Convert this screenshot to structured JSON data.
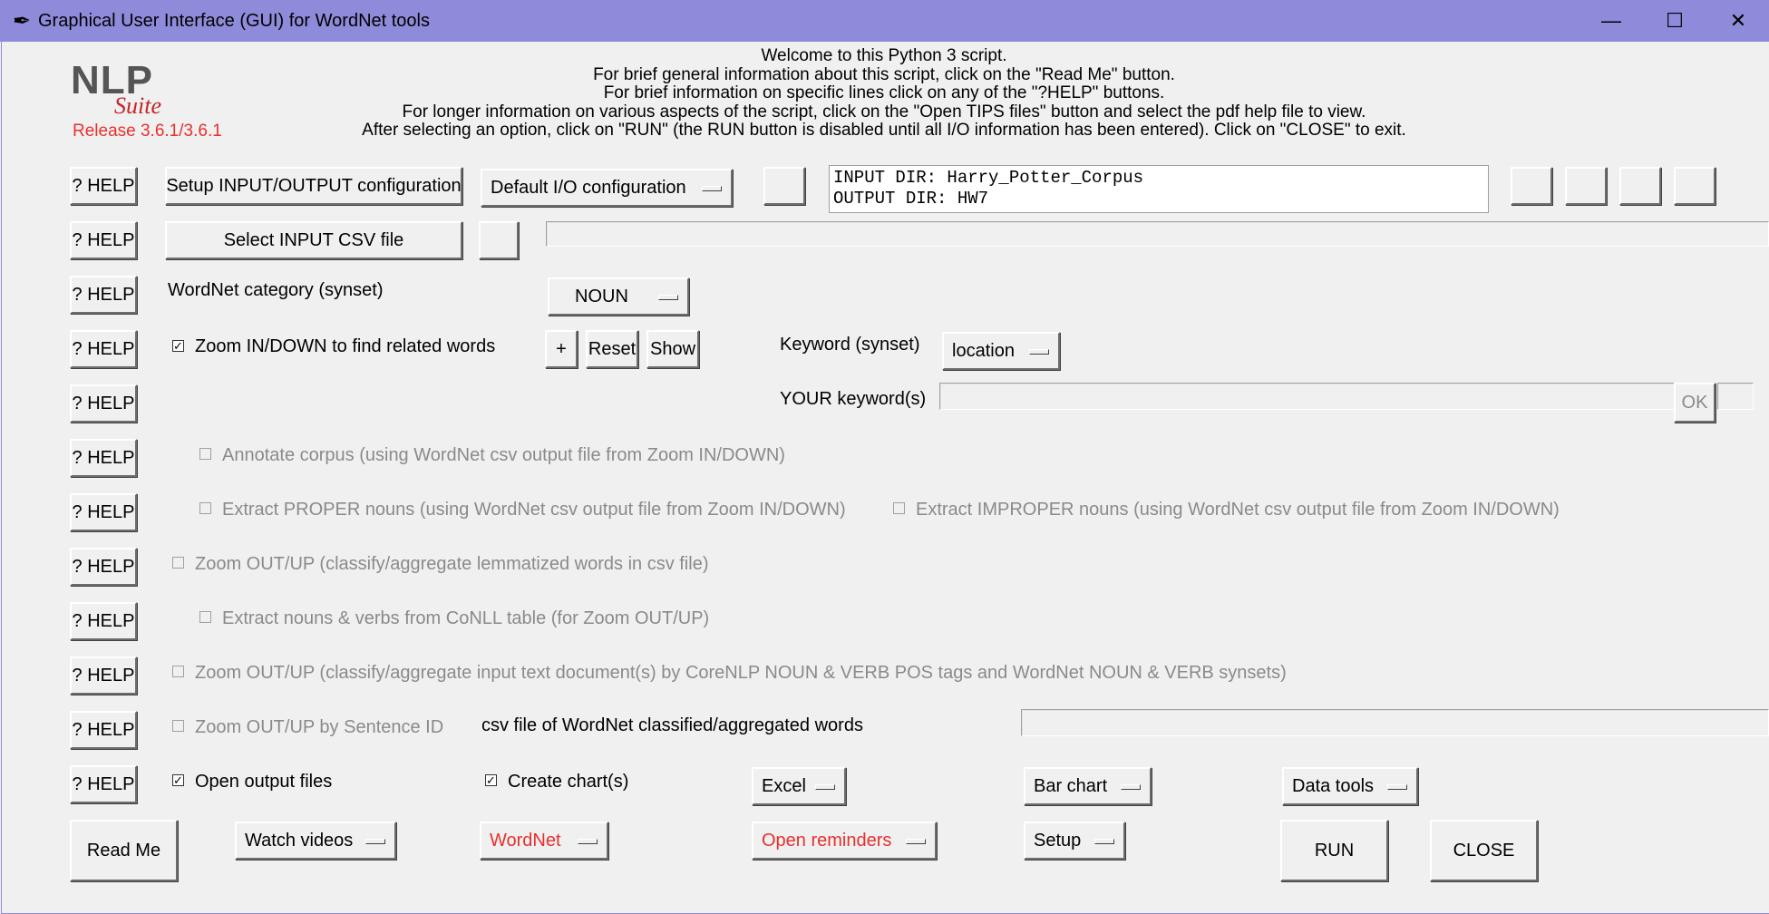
{
  "window": {
    "title": "Graphical User Interface (GUI) for WordNet tools",
    "feather_icon": "✒",
    "minimize_icon": "—",
    "maximize_icon": "☐",
    "close_icon": "✕"
  },
  "logo": {
    "nlp": "NLP",
    "suite": "Suite",
    "release": "Release 3.6.1/3.6.1"
  },
  "welcome": {
    "line1": "Welcome to this Python 3 script.",
    "line2": "For brief general information about this script, click on the \"Read Me\" button.",
    "line3": "For brief information on specific lines click on any of the \"?HELP\" buttons.",
    "line4": "For longer information on various aspects of the script, click on the \"Open TIPS files\" button and select the pdf help file to view.",
    "line5": "After selecting an option, click on \"RUN\" (the RUN button is disabled until all I/O information has been entered).   Click on \"CLOSE\" to exit."
  },
  "help_label": "? HELP",
  "io": {
    "setup_button": "Setup INPUT/OUTPUT configuration",
    "config_menu": "Default I/O configuration",
    "input_dir": "INPUT DIR: Harry_Potter_Corpus",
    "output_dir": "OUTPUT DIR: HW7"
  },
  "csv": {
    "select_button": "Select INPUT CSV file",
    "path": ""
  },
  "wordnet_category": {
    "label": "WordNet category (synset)",
    "value": "NOUN"
  },
  "zoom_in": {
    "label": "Zoom IN/DOWN to find related words",
    "checked": "✓",
    "plus": "+",
    "reset": "Reset",
    "show": "Show",
    "keyword_label": "Keyword (synset)",
    "keyword_value": "location"
  },
  "your_keyword": {
    "label": "YOUR keyword(s)",
    "value": "",
    "ok": "OK"
  },
  "options": {
    "annotate": "Annotate corpus (using WordNet csv output file from Zoom IN/DOWN)",
    "proper": "Extract PROPER nouns  (using WordNet csv output file from Zoom IN/DOWN)",
    "improper": "Extract IMPROPER nouns  (using WordNet csv output file from Zoom IN/DOWN)",
    "zoom_out_csv": "Zoom OUT/UP (classify/aggregate lemmatized words in csv file)",
    "extract_conll": "Extract nouns & verbs from CoNLL table (for Zoom OUT/UP)",
    "zoom_out_text": "Zoom OUT/UP (classify/aggregate input text document(s) by CoreNLP NOUN & VERB POS tags and WordNet NOUN & VERB synsets)",
    "zoom_out_sentence": "Zoom OUT/UP by Sentence ID",
    "csv_classified_label": "csv file of WordNet classified/aggregated words"
  },
  "output": {
    "open_files": "Open output files",
    "create_charts": "Create chart(s)",
    "excel": "Excel",
    "bar_chart": "Bar chart",
    "data_tools": "Data tools"
  },
  "bottom": {
    "read_me": "Read Me",
    "watch_videos": "Watch videos",
    "wordnet": "WordNet",
    "open_reminders": "Open reminders",
    "setup": "Setup",
    "run": "RUN",
    "close": "CLOSE"
  },
  "colors": {
    "titlebar": "#8f8bdb",
    "accent_red": "#e8302d",
    "background": "#f0f0f0"
  }
}
